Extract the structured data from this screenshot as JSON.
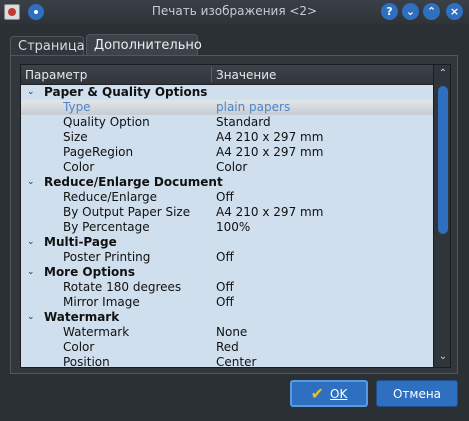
{
  "window": {
    "title": "Печать изображения <2>",
    "app_icon": "image-print-app-icon",
    "buttons": {
      "help": "?",
      "minimize": "⌄",
      "maximize": "⌃",
      "close": "×"
    }
  },
  "tabs": [
    {
      "label": "Страница",
      "active": false
    },
    {
      "label": "Дополнительно",
      "active": true
    }
  ],
  "tree": {
    "columns": {
      "param": "Параметр",
      "value": "Значение"
    },
    "rows": [
      {
        "type": "group",
        "label": "Paper & Quality Options",
        "expanded": true
      },
      {
        "type": "item",
        "label": "Type",
        "value": "plain papers",
        "selected": true
      },
      {
        "type": "item",
        "label": "Quality Option",
        "value": "Standard"
      },
      {
        "type": "item",
        "label": "Size",
        "value": "A4 210 x 297 mm"
      },
      {
        "type": "item",
        "label": "PageRegion",
        "value": "A4 210 x 297 mm"
      },
      {
        "type": "item",
        "label": "Color",
        "value": "Color"
      },
      {
        "type": "group",
        "label": "Reduce/Enlarge Document",
        "expanded": true
      },
      {
        "type": "item",
        "label": "Reduce/Enlarge",
        "value": "Off"
      },
      {
        "type": "item",
        "label": "By Output Paper Size",
        "value": "A4 210 x 297 mm"
      },
      {
        "type": "item",
        "label": "By Percentage",
        "value": "100%"
      },
      {
        "type": "group",
        "label": "Multi-Page",
        "expanded": true
      },
      {
        "type": "item",
        "label": "Poster Printing",
        "value": "Off"
      },
      {
        "type": "group",
        "label": "More Options",
        "expanded": true
      },
      {
        "type": "item",
        "label": "Rotate 180 degrees",
        "value": "Off"
      },
      {
        "type": "item",
        "label": "Mirror Image",
        "value": "Off"
      },
      {
        "type": "group",
        "label": "Watermark",
        "expanded": true
      },
      {
        "type": "item",
        "label": "Watermark",
        "value": "None"
      },
      {
        "type": "item",
        "label": "Color",
        "value": "Red"
      },
      {
        "type": "item",
        "label": "Position",
        "value": "Center"
      }
    ],
    "chevron": "⌄",
    "scroll_up": "⌃",
    "scroll_down": "⌄"
  },
  "footer": {
    "ok_label": "OK",
    "cancel_label": "Отмена",
    "ok_icon": "checkmark-icon"
  },
  "colors": {
    "accent": "#2e6fbf",
    "tree_background": "#d0dfee",
    "selected_text": "#4a86c8",
    "window_background": "#2b3035"
  }
}
